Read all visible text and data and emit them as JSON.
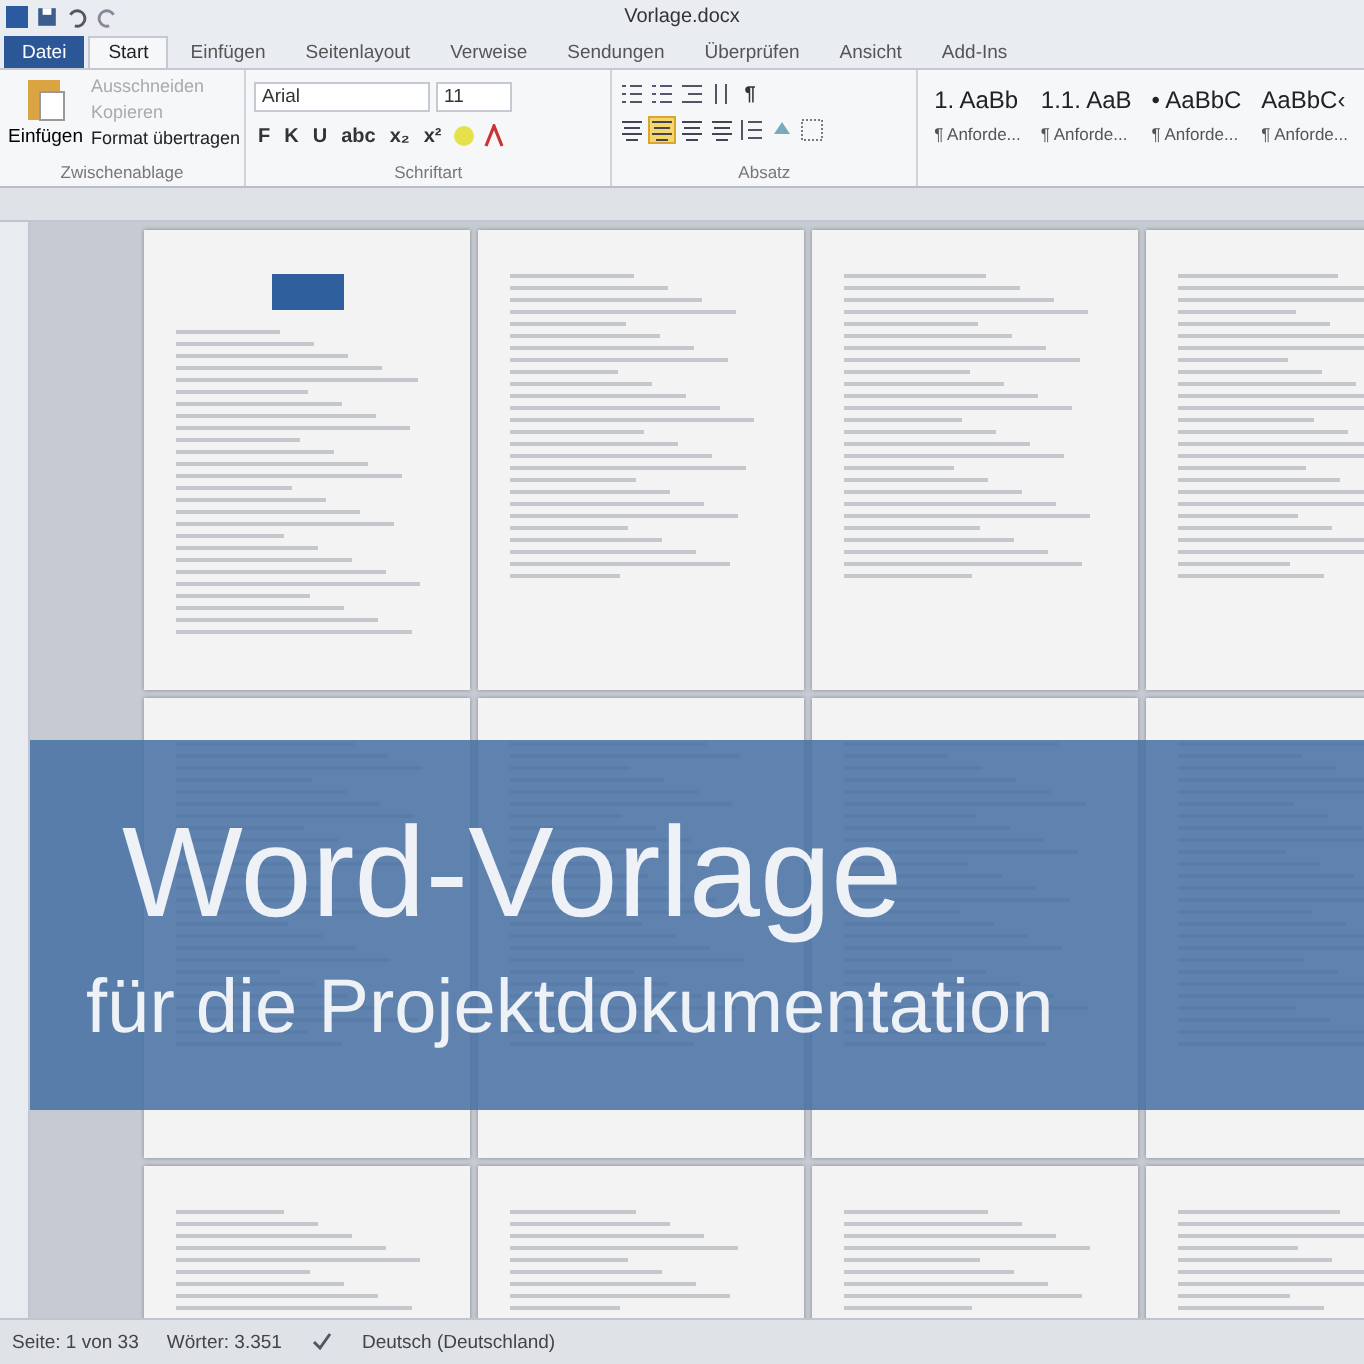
{
  "window": {
    "title": "Vorlage.docx"
  },
  "tabs": [
    {
      "label": "Datei",
      "kind": "file",
      "selected": false
    },
    {
      "label": "Start",
      "kind": "tab",
      "selected": true
    },
    {
      "label": "Einfügen",
      "kind": "tab",
      "selected": false
    },
    {
      "label": "Seitenlayout",
      "kind": "tab",
      "selected": false
    },
    {
      "label": "Verweise",
      "kind": "tab",
      "selected": false
    },
    {
      "label": "Sendungen",
      "kind": "tab",
      "selected": false
    },
    {
      "label": "Überprüfen",
      "kind": "tab",
      "selected": false
    },
    {
      "label": "Ansicht",
      "kind": "tab",
      "selected": false
    },
    {
      "label": "Add-Ins",
      "kind": "tab",
      "selected": false
    }
  ],
  "clipboard": {
    "paste": "Einfügen",
    "label": "Zwischenablage",
    "items": [
      {
        "label": "Ausschneiden",
        "disabled": true
      },
      {
        "label": "Kopieren",
        "disabled": true
      },
      {
        "label": "Format übertragen",
        "disabled": false
      }
    ]
  },
  "font": {
    "family": "Arial",
    "size": "11",
    "label": "Schriftart",
    "buttons": [
      "F",
      "K",
      "U",
      "abc",
      "x₂",
      "x²"
    ]
  },
  "paragraph": {
    "label": "Absatz",
    "pilcrow": "¶",
    "alignments": [
      {
        "selected": false
      },
      {
        "selected": true
      },
      {
        "selected": false
      },
      {
        "selected": false
      }
    ]
  },
  "styles": [
    {
      "preview": "1. AaBb",
      "name": "¶ Anforde..."
    },
    {
      "preview": "1.1. AaB",
      "name": "¶ Anforde..."
    },
    {
      "preview": "• AaBbC",
      "name": "¶ Anforde..."
    },
    {
      "preview": "AaBbC‹",
      "name": "¶ Anforde..."
    }
  ],
  "banner": {
    "title": "Word-Vorlage",
    "subtitle": "für die Projektdokumentation"
  },
  "status_bar": {
    "page": "Seite: 1 von 33",
    "words": "Wörter: 3.351",
    "language": "Deutsch (Deutschland)"
  }
}
